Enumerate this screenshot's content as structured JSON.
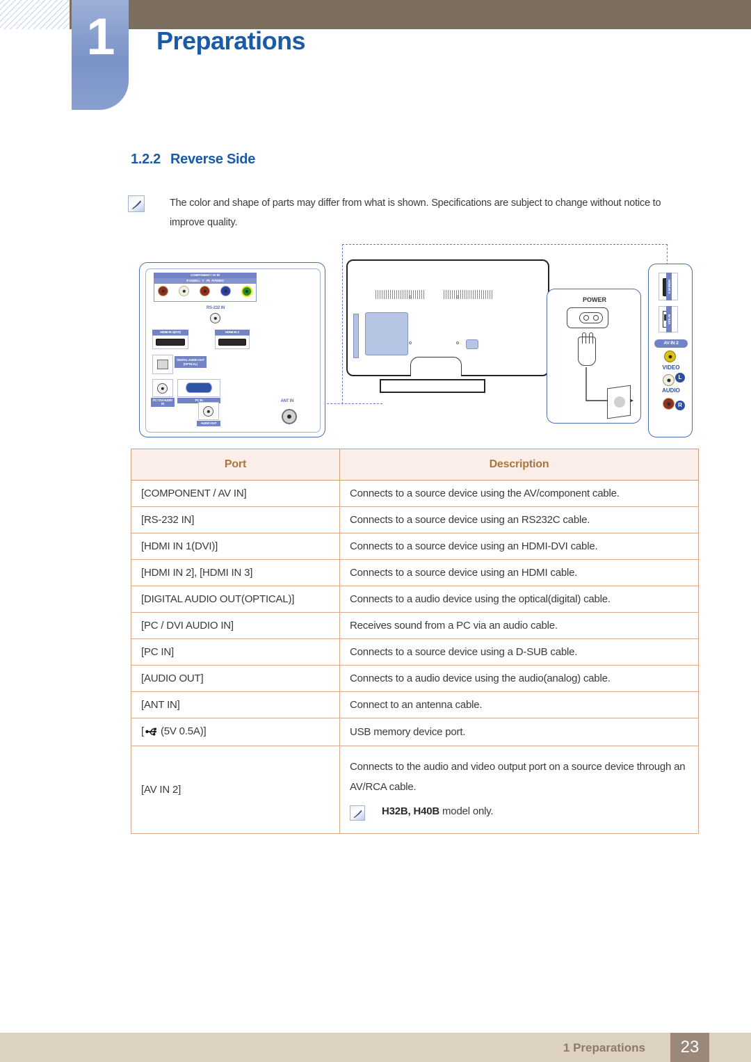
{
  "header": {
    "chapter_number": "1",
    "chapter_title": "Preparations"
  },
  "section": {
    "number": "1.2.2",
    "title": "Reverse Side"
  },
  "note": {
    "icon": "note-icon",
    "text": "The color and shape of parts may differ from what is shown. Specifications are subject to change without notice to improve quality."
  },
  "diagram": {
    "left_panel": {
      "component_group_label": "COMPONENT / AV IN",
      "jack_labels": [
        "R  AUDIO  L",
        "Y",
        "Pb",
        "Pr/VIDEO"
      ],
      "rs232_label": "RS-232 IN",
      "hdmi1_label": "HDMI IN 1(DVI)",
      "hdmi2_label": "HDMI IN 2",
      "digital_audio_label": "DIGITAL AUDIO OUT (OPTICAL)",
      "pc_dvi_audio_label": "PC / DVI AUDIO IN",
      "pc_in_label": "PC IN",
      "audio_out_label": "AUDIO OUT",
      "ant_in_label": "ANT IN"
    },
    "power_panel": {
      "label": "POWER"
    },
    "right_panel": {
      "hdmi3_label": "HDMI IN 3",
      "usb_label": "5V 0.5A",
      "av_in2_label": "AV IN 2",
      "video_label": "VIDEO",
      "audio_label": "AUDIO",
      "left_ch": "L",
      "right_ch": "R"
    }
  },
  "table": {
    "headers": [
      "Port",
      "Description"
    ],
    "rows": [
      {
        "port": "[COMPONENT / AV IN]",
        "description": "Connects to a source device using the AV/component cable."
      },
      {
        "port": "[RS-232 IN]",
        "description": "Connects to a source device using an RS232C cable."
      },
      {
        "port": "[HDMI IN 1(DVI)]",
        "description": "Connects to a source device using an HDMI-DVI cable."
      },
      {
        "port": "[HDMI IN 2], [HDMI IN 3]",
        "description": "Connects to a source device using an HDMI cable."
      },
      {
        "port": "[DIGITAL AUDIO OUT(OPTICAL)]",
        "description": "Connects to a audio device using the optical(digital) cable."
      },
      {
        "port": "[PC / DVI AUDIO IN]",
        "description": "Receives sound from a PC via an audio cable."
      },
      {
        "port": "[PC IN]",
        "description": "Connects to a source device using a D-SUB cable."
      },
      {
        "port": "[AUDIO OUT]",
        "description": "Connects to a audio device using the audio(analog) cable."
      },
      {
        "port": "[ANT IN]",
        "description": "Connect to an antenna cable."
      }
    ],
    "usb_row": {
      "port_prefix": "[",
      "port_icon": "usb-icon",
      "port_suffix": "(5V 0.5A)]",
      "description": "USB memory device port."
    },
    "av_row": {
      "port": "[AV IN 2]",
      "description": "Connects to the audio and video output port on a source device through an AV/RCA cable.",
      "note_models": "H32B, H40B",
      "note_suffix": " model only.",
      "note_icon": "note-icon"
    }
  },
  "footer": {
    "chapter": "1 Preparations",
    "page": "23"
  },
  "colors": {
    "accent_blue": "#1a5aa8",
    "header_brown": "#7d6f60",
    "badge_blue": "#7a93c7",
    "table_header_bg": "#fbeee8",
    "table_header_text": "#a9763f",
    "table_border": "#d9a98c",
    "footer_bar": "#ddd2c2",
    "footer_page_bg": "#9b8878",
    "connector_label_blue": "#7183c4"
  }
}
